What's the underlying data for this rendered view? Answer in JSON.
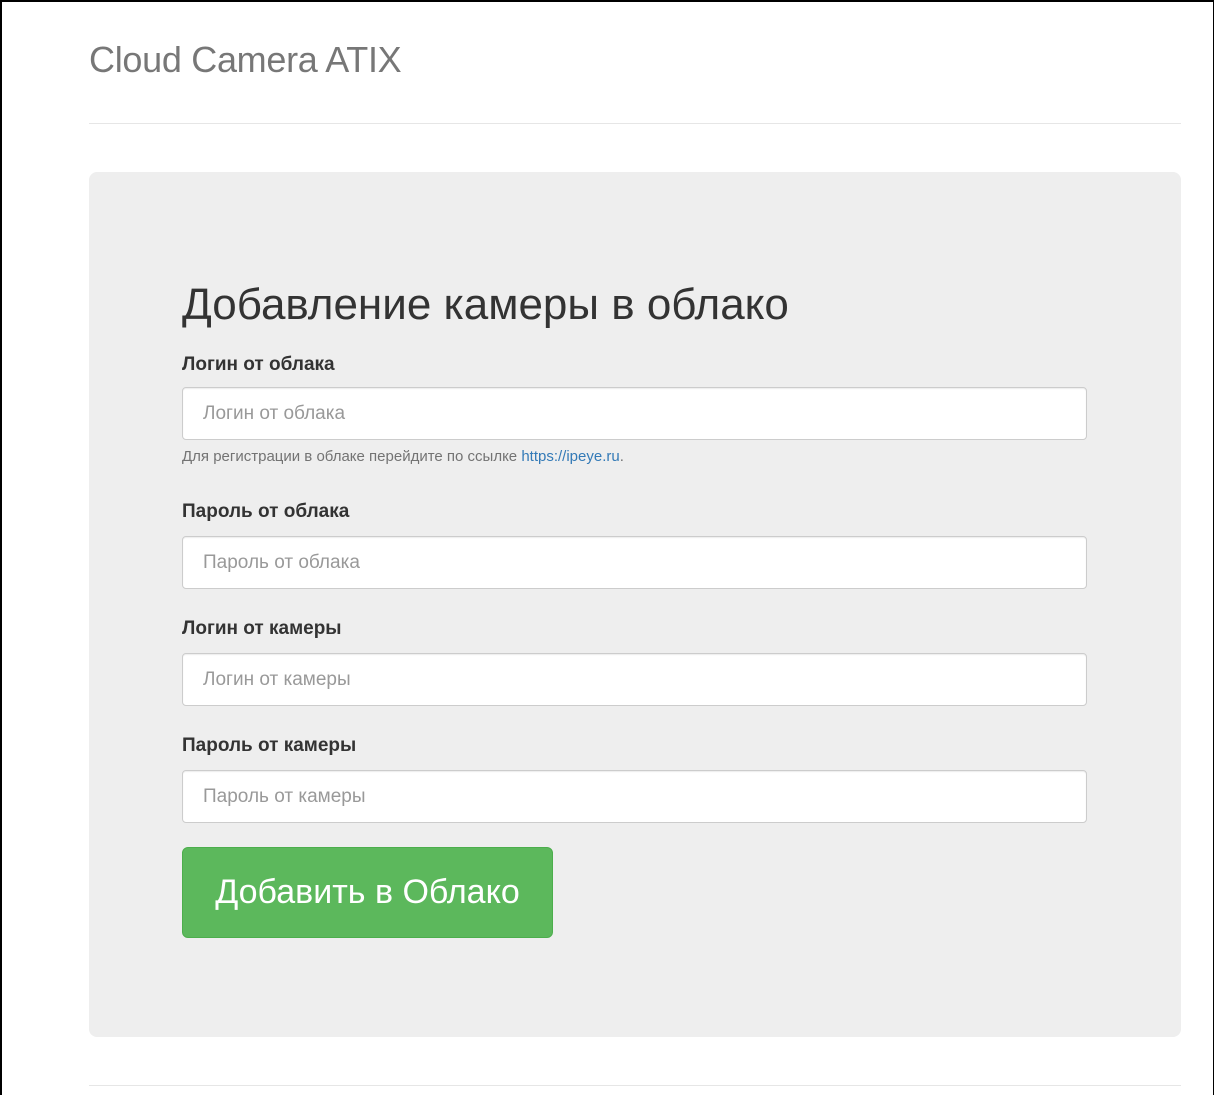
{
  "header": {
    "title": "Cloud Camera ATIX"
  },
  "form": {
    "title": "Добавление камеры в облако",
    "cloud_login": {
      "label": "Логин от облака",
      "placeholder": "Логин от облака",
      "value": ""
    },
    "help": {
      "text": "Для регистрации в облаке перейдите по ссылке ",
      "link_text": "https://ipeye.ru",
      "suffix": "."
    },
    "cloud_password": {
      "label": "Пароль от облака",
      "placeholder": "Пароль от облака",
      "value": ""
    },
    "camera_login": {
      "label": "Логин от камеры",
      "placeholder": "Логин от камеры",
      "value": ""
    },
    "camera_password": {
      "label": "Пароль от камеры",
      "placeholder": "Пароль от камеры",
      "value": ""
    },
    "submit_label": "Добавить в Облако"
  },
  "colors": {
    "accent_green": "#5cb85c",
    "link_blue": "#337ab7",
    "panel_bg": "#eeeeee"
  }
}
